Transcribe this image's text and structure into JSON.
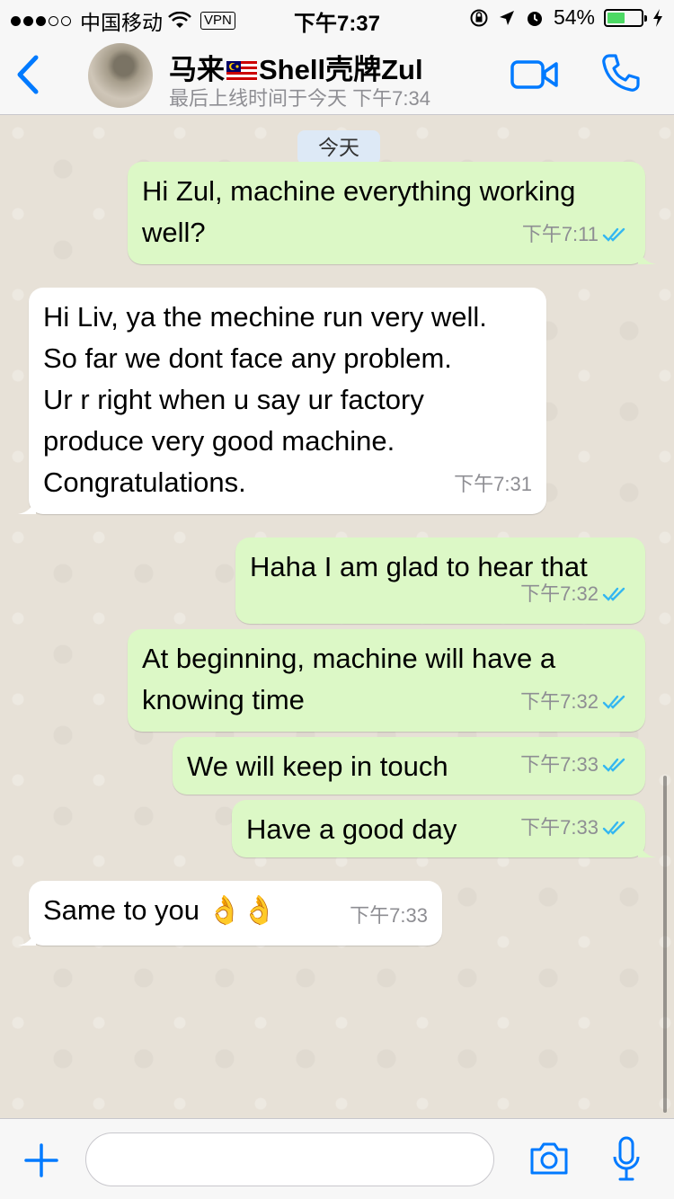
{
  "status_bar": {
    "carrier": "中国移动",
    "vpn": "VPN",
    "time": "下午7:37",
    "battery": "54%",
    "battery_level": 0.54
  },
  "header": {
    "name_prefix": "马来",
    "name_suffix": "Shell壳牌Zul",
    "last_seen": "最后上线时间于今天 下午7:34"
  },
  "chat": {
    "date_chip": "今天",
    "messages": [
      {
        "dir": "out",
        "text": "Hi Zul, machine everything working\nwell?",
        "time": "下午7:11",
        "read": true
      },
      {
        "dir": "in",
        "text": "Hi Liv, ya the mechine run very well.\nSo far we dont face any problem.\nUr r right when u say ur factory\nproduce very good machine.\nCongratulations.",
        "time": "下午7:31"
      },
      {
        "dir": "out",
        "text": "Haha I am glad to hear that",
        "time": "下午7:32",
        "read": true
      },
      {
        "dir": "out",
        "text": "At beginning, machine will have a\nknowing time",
        "time": "下午7:32",
        "read": true
      },
      {
        "dir": "out",
        "text": "We will keep in touch",
        "time": "下午7:33",
        "read": true
      },
      {
        "dir": "out",
        "text": "Have a good day",
        "time": "下午7:33",
        "read": true
      },
      {
        "dir": "in",
        "text": "Same to you 👌👌",
        "time": "下午7:33"
      }
    ]
  },
  "input": {
    "placeholder": ""
  },
  "colors": {
    "accent": "#007aff",
    "outgoing_bubble": "#dcf8c6",
    "incoming_bubble": "#ffffff",
    "read_ticks": "#34b7f1"
  },
  "icons": [
    "back-chevron-icon",
    "video-call-icon",
    "phone-icon",
    "plus-icon",
    "camera-icon",
    "microphone-icon",
    "double-check-icon"
  ]
}
